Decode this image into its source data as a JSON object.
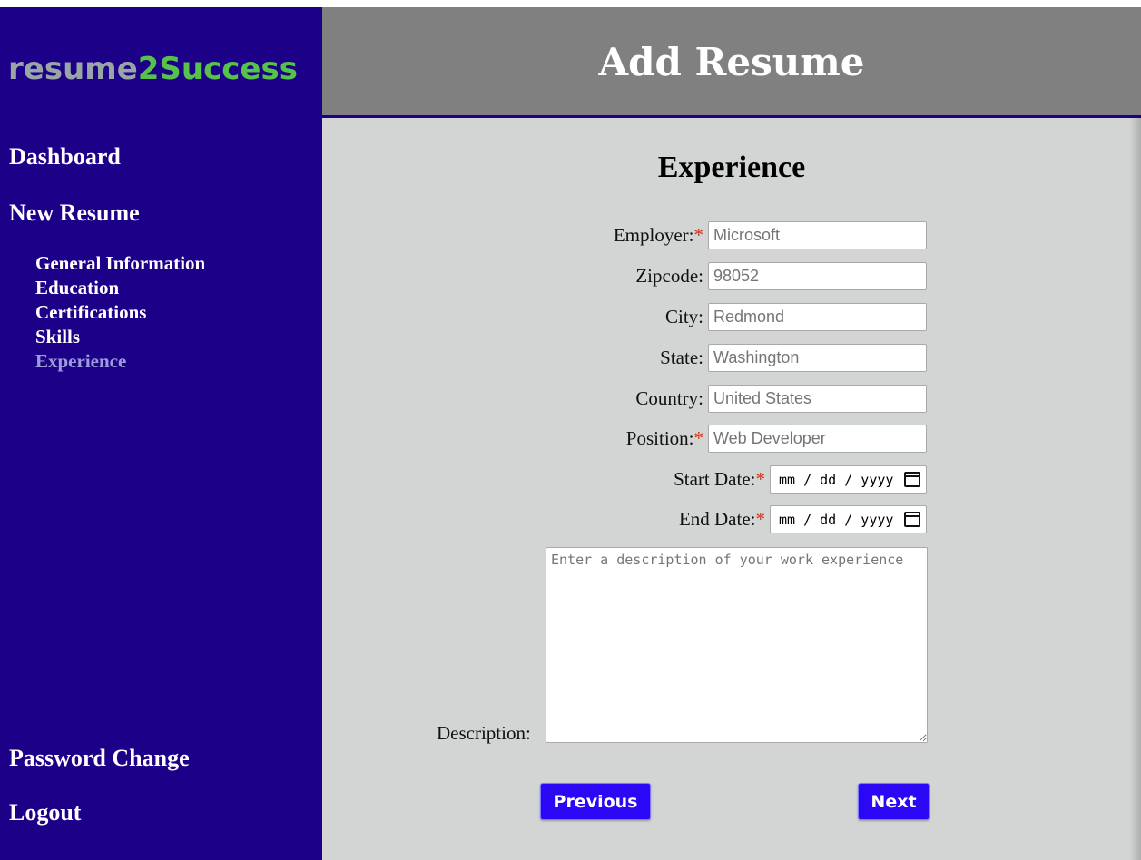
{
  "brand": {
    "part1": "resume",
    "part2": "2Success"
  },
  "header": {
    "title": "Add Resume"
  },
  "sidebar": {
    "dashboard": "Dashboard",
    "new_resume": "New Resume",
    "subitems": [
      "General Information",
      "Education",
      "Certifications",
      "Skills",
      "Experience"
    ],
    "active_subitem": "Experience",
    "password_change": "Password Change",
    "logout": "Logout"
  },
  "section": {
    "title": "Experience"
  },
  "form": {
    "required_marker": "*",
    "employer": {
      "label": "Employer:",
      "placeholder": "Microsoft"
    },
    "zipcode": {
      "label": "Zipcode:",
      "placeholder": "98052"
    },
    "city": {
      "label": "City:",
      "placeholder": "Redmond"
    },
    "state": {
      "label": "State:",
      "placeholder": "Washington"
    },
    "country": {
      "label": "Country:",
      "placeholder": "United States"
    },
    "position": {
      "label": "Position:",
      "placeholder": "Web Developer"
    },
    "start_date": {
      "label": "Start Date:",
      "placeholder": "mm / dd / yyyy"
    },
    "end_date": {
      "label": "End Date:",
      "placeholder": "mm / dd / yyyy"
    },
    "description": {
      "label": "Description:",
      "placeholder": "Enter a description of your work experience"
    }
  },
  "buttons": {
    "previous": "Previous",
    "next": "Next"
  },
  "colors": {
    "sidebar_bg": "#1c0087",
    "header_bg": "#808080",
    "main_bg": "#d3d4d4",
    "button_bg": "#2b08f5",
    "brand_gray": "#9aa5a5",
    "brand_green": "#56c24a",
    "required": "#d3301a",
    "active_nav": "#9c9cdc"
  }
}
